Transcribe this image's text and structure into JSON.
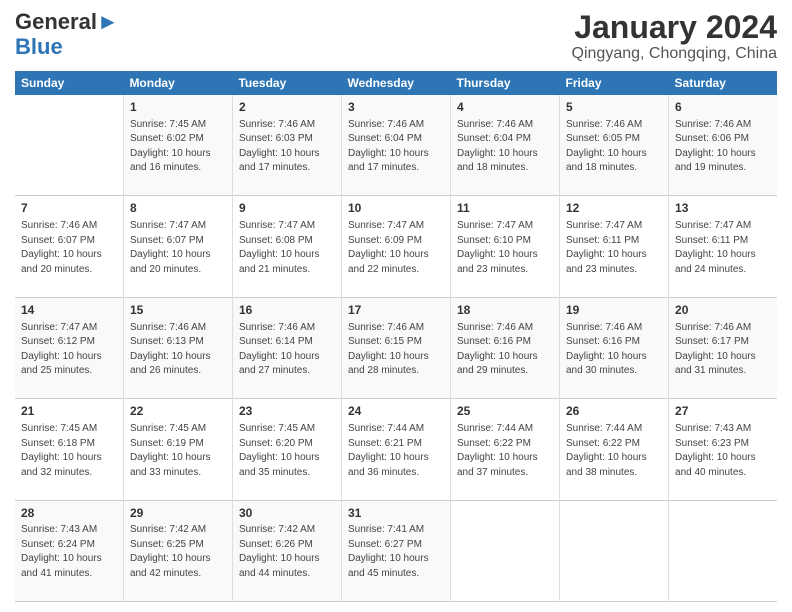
{
  "logo": {
    "line1": "General",
    "line2": "Blue"
  },
  "title": "January 2024",
  "subtitle": "Qingyang, Chongqing, China",
  "weekdays": [
    "Sunday",
    "Monday",
    "Tuesday",
    "Wednesday",
    "Thursday",
    "Friday",
    "Saturday"
  ],
  "weeks": [
    [
      {
        "day": "",
        "sunrise": "",
        "sunset": "",
        "daylight": ""
      },
      {
        "day": "1",
        "sunrise": "Sunrise: 7:45 AM",
        "sunset": "Sunset: 6:02 PM",
        "daylight": "Daylight: 10 hours and 16 minutes."
      },
      {
        "day": "2",
        "sunrise": "Sunrise: 7:46 AM",
        "sunset": "Sunset: 6:03 PM",
        "daylight": "Daylight: 10 hours and 17 minutes."
      },
      {
        "day": "3",
        "sunrise": "Sunrise: 7:46 AM",
        "sunset": "Sunset: 6:04 PM",
        "daylight": "Daylight: 10 hours and 17 minutes."
      },
      {
        "day": "4",
        "sunrise": "Sunrise: 7:46 AM",
        "sunset": "Sunset: 6:04 PM",
        "daylight": "Daylight: 10 hours and 18 minutes."
      },
      {
        "day": "5",
        "sunrise": "Sunrise: 7:46 AM",
        "sunset": "Sunset: 6:05 PM",
        "daylight": "Daylight: 10 hours and 18 minutes."
      },
      {
        "day": "6",
        "sunrise": "Sunrise: 7:46 AM",
        "sunset": "Sunset: 6:06 PM",
        "daylight": "Daylight: 10 hours and 19 minutes."
      }
    ],
    [
      {
        "day": "7",
        "sunrise": "Sunrise: 7:46 AM",
        "sunset": "Sunset: 6:07 PM",
        "daylight": "Daylight: 10 hours and 20 minutes."
      },
      {
        "day": "8",
        "sunrise": "Sunrise: 7:47 AM",
        "sunset": "Sunset: 6:07 PM",
        "daylight": "Daylight: 10 hours and 20 minutes."
      },
      {
        "day": "9",
        "sunrise": "Sunrise: 7:47 AM",
        "sunset": "Sunset: 6:08 PM",
        "daylight": "Daylight: 10 hours and 21 minutes."
      },
      {
        "day": "10",
        "sunrise": "Sunrise: 7:47 AM",
        "sunset": "Sunset: 6:09 PM",
        "daylight": "Daylight: 10 hours and 22 minutes."
      },
      {
        "day": "11",
        "sunrise": "Sunrise: 7:47 AM",
        "sunset": "Sunset: 6:10 PM",
        "daylight": "Daylight: 10 hours and 23 minutes."
      },
      {
        "day": "12",
        "sunrise": "Sunrise: 7:47 AM",
        "sunset": "Sunset: 6:11 PM",
        "daylight": "Daylight: 10 hours and 23 minutes."
      },
      {
        "day": "13",
        "sunrise": "Sunrise: 7:47 AM",
        "sunset": "Sunset: 6:11 PM",
        "daylight": "Daylight: 10 hours and 24 minutes."
      }
    ],
    [
      {
        "day": "14",
        "sunrise": "Sunrise: 7:47 AM",
        "sunset": "Sunset: 6:12 PM",
        "daylight": "Daylight: 10 hours and 25 minutes."
      },
      {
        "day": "15",
        "sunrise": "Sunrise: 7:46 AM",
        "sunset": "Sunset: 6:13 PM",
        "daylight": "Daylight: 10 hours and 26 minutes."
      },
      {
        "day": "16",
        "sunrise": "Sunrise: 7:46 AM",
        "sunset": "Sunset: 6:14 PM",
        "daylight": "Daylight: 10 hours and 27 minutes."
      },
      {
        "day": "17",
        "sunrise": "Sunrise: 7:46 AM",
        "sunset": "Sunset: 6:15 PM",
        "daylight": "Daylight: 10 hours and 28 minutes."
      },
      {
        "day": "18",
        "sunrise": "Sunrise: 7:46 AM",
        "sunset": "Sunset: 6:16 PM",
        "daylight": "Daylight: 10 hours and 29 minutes."
      },
      {
        "day": "19",
        "sunrise": "Sunrise: 7:46 AM",
        "sunset": "Sunset: 6:16 PM",
        "daylight": "Daylight: 10 hours and 30 minutes."
      },
      {
        "day": "20",
        "sunrise": "Sunrise: 7:46 AM",
        "sunset": "Sunset: 6:17 PM",
        "daylight": "Daylight: 10 hours and 31 minutes."
      }
    ],
    [
      {
        "day": "21",
        "sunrise": "Sunrise: 7:45 AM",
        "sunset": "Sunset: 6:18 PM",
        "daylight": "Daylight: 10 hours and 32 minutes."
      },
      {
        "day": "22",
        "sunrise": "Sunrise: 7:45 AM",
        "sunset": "Sunset: 6:19 PM",
        "daylight": "Daylight: 10 hours and 33 minutes."
      },
      {
        "day": "23",
        "sunrise": "Sunrise: 7:45 AM",
        "sunset": "Sunset: 6:20 PM",
        "daylight": "Daylight: 10 hours and 35 minutes."
      },
      {
        "day": "24",
        "sunrise": "Sunrise: 7:44 AM",
        "sunset": "Sunset: 6:21 PM",
        "daylight": "Daylight: 10 hours and 36 minutes."
      },
      {
        "day": "25",
        "sunrise": "Sunrise: 7:44 AM",
        "sunset": "Sunset: 6:22 PM",
        "daylight": "Daylight: 10 hours and 37 minutes."
      },
      {
        "day": "26",
        "sunrise": "Sunrise: 7:44 AM",
        "sunset": "Sunset: 6:22 PM",
        "daylight": "Daylight: 10 hours and 38 minutes."
      },
      {
        "day": "27",
        "sunrise": "Sunrise: 7:43 AM",
        "sunset": "Sunset: 6:23 PM",
        "daylight": "Daylight: 10 hours and 40 minutes."
      }
    ],
    [
      {
        "day": "28",
        "sunrise": "Sunrise: 7:43 AM",
        "sunset": "Sunset: 6:24 PM",
        "daylight": "Daylight: 10 hours and 41 minutes."
      },
      {
        "day": "29",
        "sunrise": "Sunrise: 7:42 AM",
        "sunset": "Sunset: 6:25 PM",
        "daylight": "Daylight: 10 hours and 42 minutes."
      },
      {
        "day": "30",
        "sunrise": "Sunrise: 7:42 AM",
        "sunset": "Sunset: 6:26 PM",
        "daylight": "Daylight: 10 hours and 44 minutes."
      },
      {
        "day": "31",
        "sunrise": "Sunrise: 7:41 AM",
        "sunset": "Sunset: 6:27 PM",
        "daylight": "Daylight: 10 hours and 45 minutes."
      },
      {
        "day": "",
        "sunrise": "",
        "sunset": "",
        "daylight": ""
      },
      {
        "day": "",
        "sunrise": "",
        "sunset": "",
        "daylight": ""
      },
      {
        "day": "",
        "sunrise": "",
        "sunset": "",
        "daylight": ""
      }
    ]
  ]
}
